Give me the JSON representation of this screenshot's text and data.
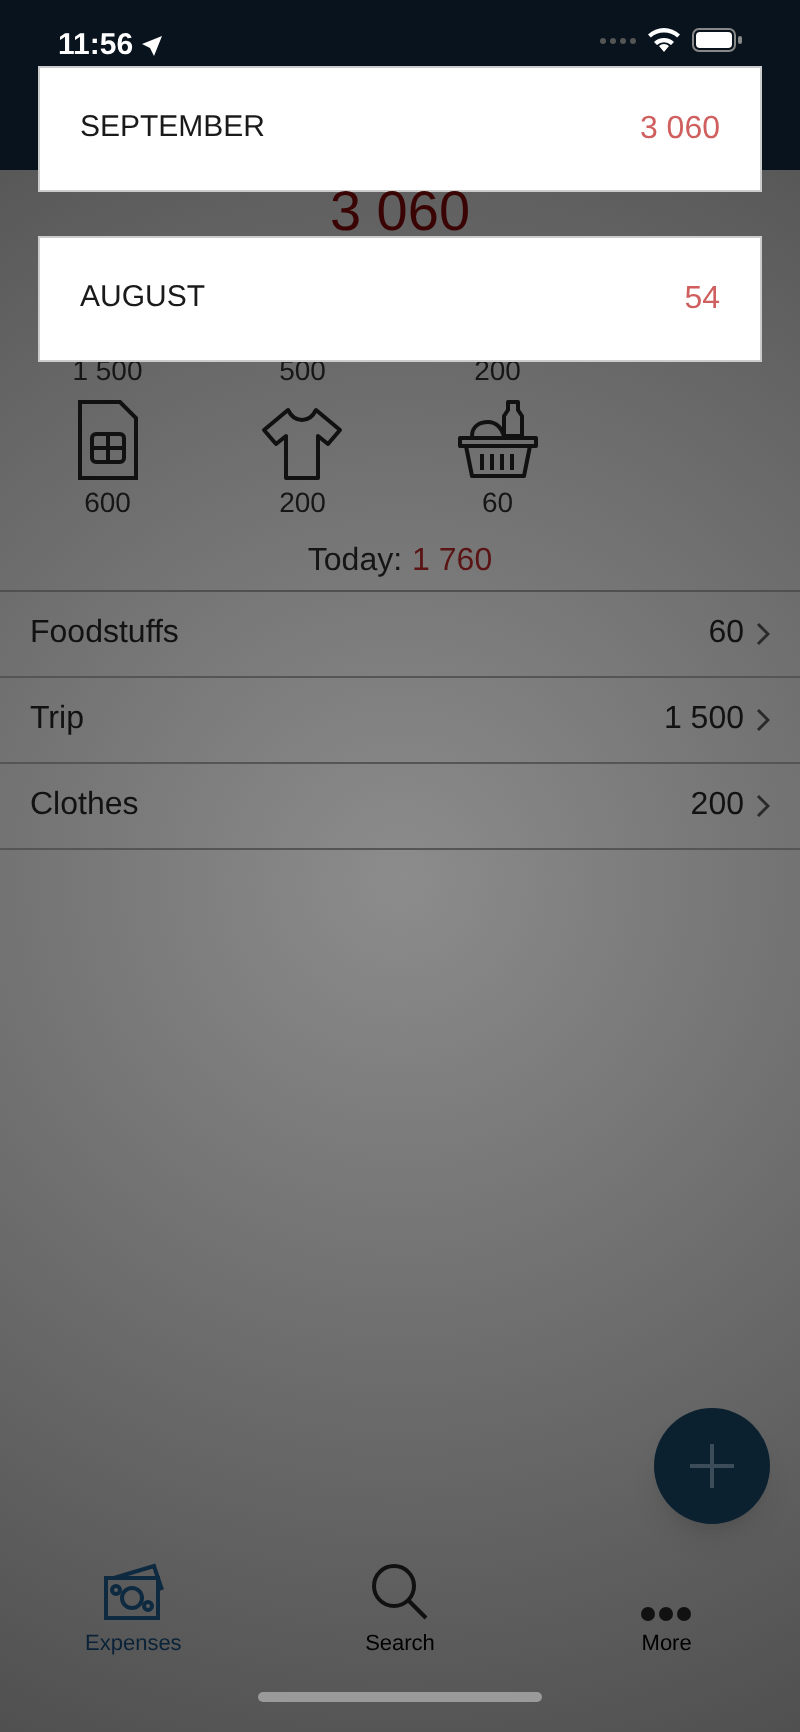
{
  "status_bar": {
    "time": "11:56"
  },
  "total": "3 060",
  "categories": [
    {
      "kind": "hidden",
      "amount": "1 500"
    },
    {
      "kind": "hidden",
      "amount": "500"
    },
    {
      "kind": "hidden",
      "amount": "200"
    },
    {
      "kind": "sim",
      "amount": "600"
    },
    {
      "kind": "shirt",
      "amount": "200"
    },
    {
      "kind": "basket",
      "amount": "60"
    }
  ],
  "today": {
    "label": "Today:",
    "amount": "1 760"
  },
  "expenses": [
    {
      "name": "Foodstuffs",
      "amount": "60"
    },
    {
      "name": "Trip",
      "amount": "1 500"
    },
    {
      "name": "Clothes",
      "amount": "200"
    }
  ],
  "month_popup": [
    {
      "month": "SEPTEMBER",
      "amount": "3 060"
    },
    {
      "month": "AUGUST",
      "amount": "54"
    }
  ],
  "tabs": [
    {
      "kind": "money",
      "label": "Expenses",
      "selected": true
    },
    {
      "kind": "search",
      "label": "Search",
      "selected": false
    },
    {
      "kind": "more",
      "label": "More",
      "selected": false
    }
  ]
}
